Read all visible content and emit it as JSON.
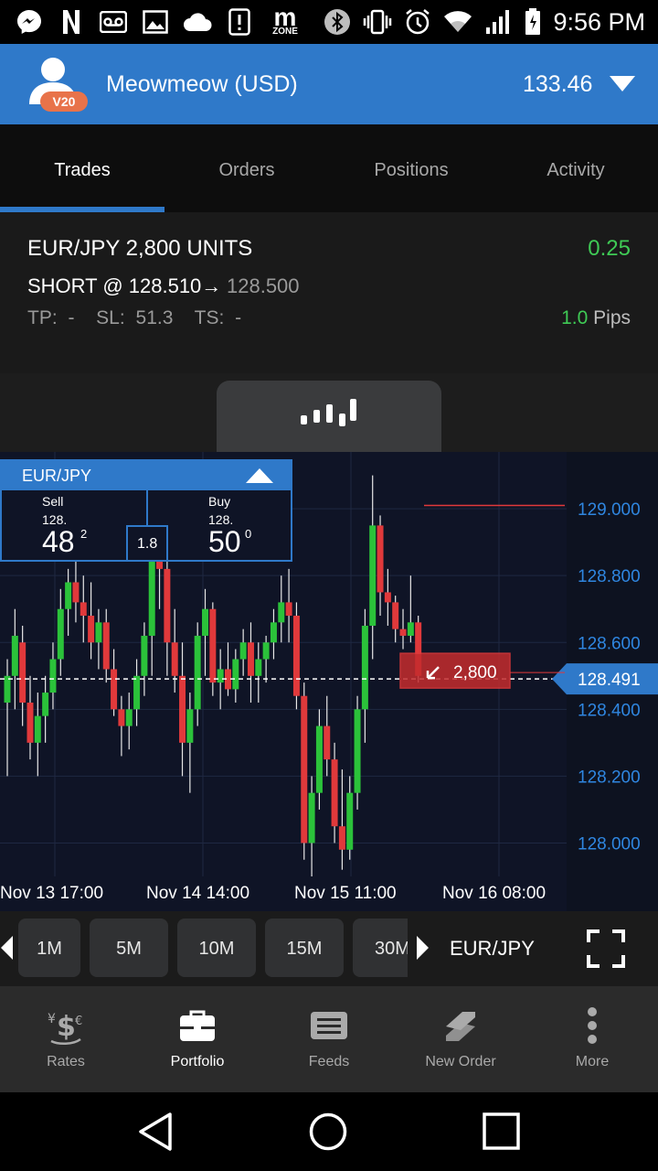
{
  "status_bar": {
    "time": "9:56 PM",
    "left_icons": [
      "messenger-icon",
      "netflix-icon",
      "voicemail-icon",
      "gallery-icon",
      "cloud-icon",
      "alert-icon",
      "mzone-icon"
    ],
    "mzone_text": "m",
    "mzone_sub": "ZONE",
    "right_icons": [
      "bluetooth-icon",
      "vibrate-icon",
      "alarm-icon",
      "wifi-icon",
      "signal-icon",
      "battery-icon"
    ]
  },
  "account": {
    "badge": "V20",
    "name": "Meowmeow (USD)",
    "balance": "133.46"
  },
  "tabs": [
    {
      "label": "Trades",
      "active": true
    },
    {
      "label": "Orders",
      "active": false
    },
    {
      "label": "Positions",
      "active": false
    },
    {
      "label": "Activity",
      "active": false
    }
  ],
  "trade": {
    "title": "EUR/JPY 2,800 UNITS",
    "pl": "0.25",
    "short": "SHORT @ 128.510",
    "arrow": "→",
    "current": "128.500",
    "tp_sl_ts": "TP: -  SL: 51.3  TS: -",
    "pips_value": "1.0",
    "pips_unit": "Pips"
  },
  "ticket": {
    "pair": "EUR/JPY",
    "sell_label": "Sell",
    "sell_prefix": "128.",
    "sell_big": "48",
    "sell_sup": "2",
    "spread": "1.8",
    "buy_label": "Buy",
    "buy_prefix": "128.",
    "buy_big": "50",
    "buy_sup": "0"
  },
  "chart_data": {
    "type": "candlestick",
    "pair": "EUR/JPY",
    "x_tick_labels": [
      "Nov 13 17:00",
      "Nov 14 14:00",
      "Nov 15 11:00",
      "Nov 16 08:00"
    ],
    "y_tick_labels": [
      "129.000",
      "128.800",
      "128.600",
      "128.400",
      "128.200",
      "128.000"
    ],
    "y_ticks": [
      129.0,
      128.8,
      128.6,
      128.4,
      128.2,
      128.0
    ],
    "ylim": [
      127.9,
      129.17
    ],
    "current_price": 128.491,
    "current_price_label": "128.491",
    "position_label": "2,800",
    "position_price": 128.51,
    "stop_loss_price": 129.01,
    "colors": {
      "up": "#2bc23a",
      "down": "#e0393b",
      "bg": "#0f1426",
      "price_tag": "#2f79c9"
    },
    "candles": [
      {
        "o": 128.42,
        "h": 128.55,
        "l": 128.2,
        "c": 128.5
      },
      {
        "o": 128.5,
        "h": 128.7,
        "l": 128.4,
        "c": 128.62
      },
      {
        "o": 128.6,
        "h": 128.65,
        "l": 128.35,
        "c": 128.42
      },
      {
        "o": 128.42,
        "h": 128.5,
        "l": 128.25,
        "c": 128.3
      },
      {
        "o": 128.3,
        "h": 128.45,
        "l": 128.2,
        "c": 128.38
      },
      {
        "o": 128.38,
        "h": 128.5,
        "l": 128.3,
        "c": 128.45
      },
      {
        "o": 128.45,
        "h": 128.6,
        "l": 128.4,
        "c": 128.55
      },
      {
        "o": 128.55,
        "h": 128.76,
        "l": 128.5,
        "c": 128.7
      },
      {
        "o": 128.7,
        "h": 128.82,
        "l": 128.62,
        "c": 128.78
      },
      {
        "o": 128.78,
        "h": 128.86,
        "l": 128.66,
        "c": 128.72
      },
      {
        "o": 128.72,
        "h": 128.8,
        "l": 128.6,
        "c": 128.68
      },
      {
        "o": 128.68,
        "h": 128.78,
        "l": 128.55,
        "c": 128.6
      },
      {
        "o": 128.6,
        "h": 128.7,
        "l": 128.52,
        "c": 128.66
      },
      {
        "o": 128.66,
        "h": 128.7,
        "l": 128.48,
        "c": 128.52
      },
      {
        "o": 128.52,
        "h": 128.58,
        "l": 128.38,
        "c": 128.4
      },
      {
        "o": 128.4,
        "h": 128.44,
        "l": 128.26,
        "c": 128.35
      },
      {
        "o": 128.35,
        "h": 128.45,
        "l": 128.28,
        "c": 128.4
      },
      {
        "o": 128.4,
        "h": 128.55,
        "l": 128.35,
        "c": 128.5
      },
      {
        "o": 128.5,
        "h": 128.66,
        "l": 128.44,
        "c": 128.62
      },
      {
        "o": 128.62,
        "h": 129.12,
        "l": 128.5,
        "c": 128.95
      },
      {
        "o": 128.95,
        "h": 129.12,
        "l": 128.7,
        "c": 128.82
      },
      {
        "o": 128.82,
        "h": 128.92,
        "l": 128.5,
        "c": 128.6
      },
      {
        "o": 128.6,
        "h": 128.7,
        "l": 128.45,
        "c": 128.5
      },
      {
        "o": 128.5,
        "h": 128.6,
        "l": 128.2,
        "c": 128.3
      },
      {
        "o": 128.3,
        "h": 128.45,
        "l": 128.15,
        "c": 128.4
      },
      {
        "o": 128.4,
        "h": 128.66,
        "l": 128.35,
        "c": 128.62
      },
      {
        "o": 128.62,
        "h": 128.76,
        "l": 128.5,
        "c": 128.7
      },
      {
        "o": 128.7,
        "h": 128.72,
        "l": 128.44,
        "c": 128.48
      },
      {
        "o": 128.48,
        "h": 128.58,
        "l": 128.4,
        "c": 128.52
      },
      {
        "o": 128.52,
        "h": 128.6,
        "l": 128.44,
        "c": 128.46
      },
      {
        "o": 128.46,
        "h": 128.58,
        "l": 128.42,
        "c": 128.55
      },
      {
        "o": 128.55,
        "h": 128.64,
        "l": 128.5,
        "c": 128.6
      },
      {
        "o": 128.6,
        "h": 128.66,
        "l": 128.42,
        "c": 128.5
      },
      {
        "o": 128.5,
        "h": 128.6,
        "l": 128.42,
        "c": 128.55
      },
      {
        "o": 128.55,
        "h": 128.62,
        "l": 128.48,
        "c": 128.6
      },
      {
        "o": 128.6,
        "h": 128.7,
        "l": 128.55,
        "c": 128.66
      },
      {
        "o": 128.66,
        "h": 128.8,
        "l": 128.6,
        "c": 128.72
      },
      {
        "o": 128.72,
        "h": 128.82,
        "l": 128.6,
        "c": 128.68
      },
      {
        "o": 128.68,
        "h": 128.72,
        "l": 128.4,
        "c": 128.44
      },
      {
        "o": 128.44,
        "h": 128.48,
        "l": 127.95,
        "c": 128.0
      },
      {
        "o": 128.0,
        "h": 128.2,
        "l": 127.9,
        "c": 128.15
      },
      {
        "o": 128.15,
        "h": 128.4,
        "l": 128.1,
        "c": 128.35
      },
      {
        "o": 128.35,
        "h": 128.44,
        "l": 128.2,
        "c": 128.25
      },
      {
        "o": 128.25,
        "h": 128.3,
        "l": 128.0,
        "c": 128.05
      },
      {
        "o": 128.05,
        "h": 128.22,
        "l": 127.92,
        "c": 127.98
      },
      {
        "o": 127.98,
        "h": 128.2,
        "l": 127.95,
        "c": 128.15
      },
      {
        "o": 128.15,
        "h": 128.44,
        "l": 128.1,
        "c": 128.4
      },
      {
        "o": 128.4,
        "h": 128.7,
        "l": 128.3,
        "c": 128.65
      },
      {
        "o": 128.65,
        "h": 129.1,
        "l": 128.55,
        "c": 128.95
      },
      {
        "o": 128.95,
        "h": 128.98,
        "l": 128.68,
        "c": 128.75
      },
      {
        "o": 128.75,
        "h": 128.82,
        "l": 128.65,
        "c": 128.72
      },
      {
        "o": 128.72,
        "h": 128.74,
        "l": 128.6,
        "c": 128.64
      },
      {
        "o": 128.64,
        "h": 128.7,
        "l": 128.58,
        "c": 128.62
      },
      {
        "o": 128.62,
        "h": 128.8,
        "l": 128.6,
        "c": 128.66
      },
      {
        "o": 128.66,
        "h": 128.68,
        "l": 128.48,
        "c": 128.5
      }
    ]
  },
  "timeframes": [
    "1M",
    "5M",
    "10M",
    "15M",
    "30M"
  ],
  "tf_pair": "EUR/JPY",
  "nav": [
    {
      "label": "Rates",
      "icon": "rates-icon",
      "active": false
    },
    {
      "label": "Portfolio",
      "icon": "briefcase-icon",
      "active": true
    },
    {
      "label": "Feeds",
      "icon": "feeds-icon",
      "active": false
    },
    {
      "label": "New Order",
      "icon": "new-order-icon",
      "active": false
    },
    {
      "label": "More",
      "icon": "more-icon",
      "active": false
    }
  ]
}
